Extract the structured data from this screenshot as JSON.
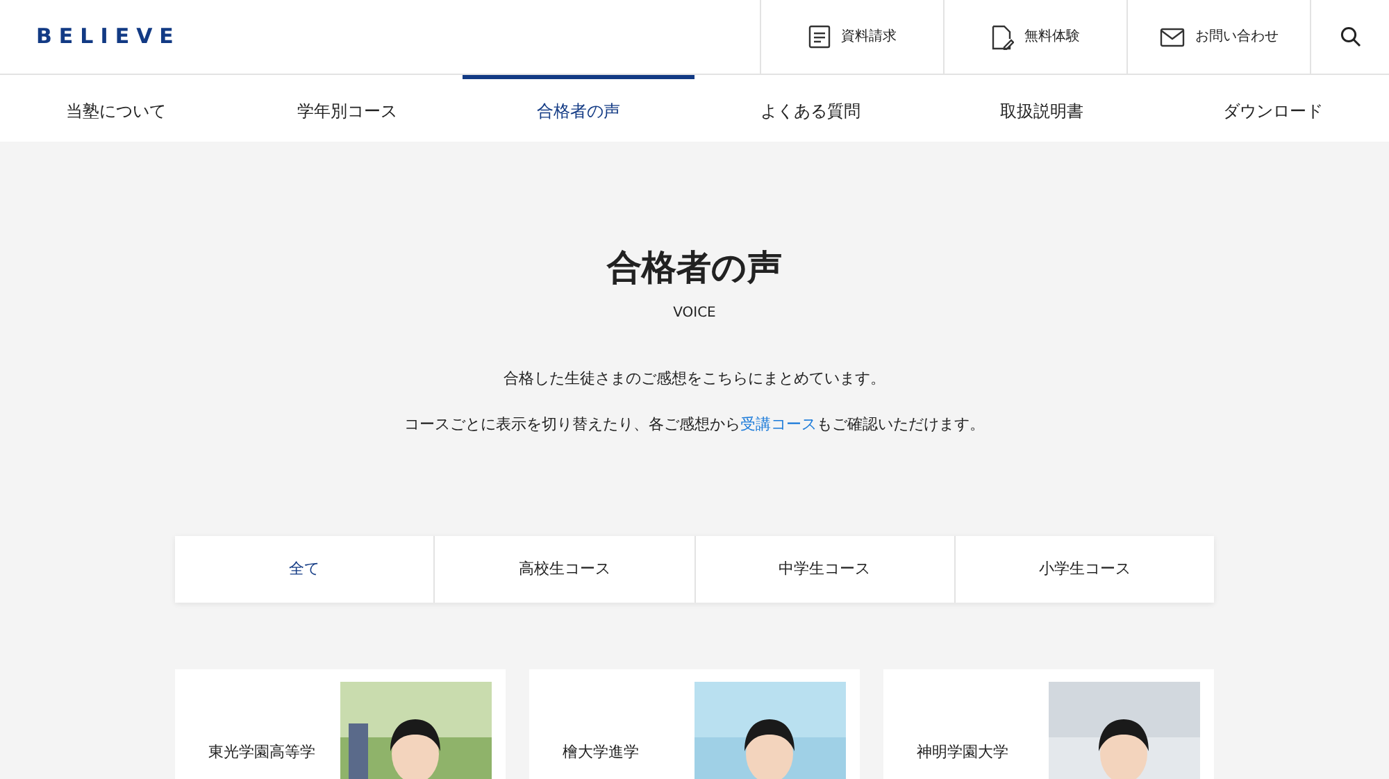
{
  "logo": "BELIEVE",
  "header_links": [
    {
      "kind": "document",
      "label": "資料請求"
    },
    {
      "kind": "trial",
      "label": "無料体験"
    },
    {
      "kind": "mail",
      "label": "お問い合わせ"
    },
    {
      "kind": "search"
    }
  ],
  "nav": [
    {
      "label": "当塾について",
      "selected": false
    },
    {
      "label": "学年別コース",
      "selected": false
    },
    {
      "label": "合格者の声",
      "selected": true
    },
    {
      "label": "よくある質問",
      "selected": false
    },
    {
      "label": "取扱説明書",
      "selected": false
    },
    {
      "label": "ダウンロード",
      "selected": false
    }
  ],
  "page_title": "合格者の声",
  "page_subtitle": "VOICE",
  "intro": [
    {
      "text": "合格した生徒さまのご感想をこちらにまとめています。"
    },
    {
      "text": "コースごとに表示を切り替えたり、各ご感想から",
      "link": "受講コース",
      "after": "もご確認いただけます。"
    }
  ],
  "filters": [
    {
      "label": "全て",
      "selected": true
    },
    {
      "label": "高校生コース",
      "selected": false
    },
    {
      "label": "中学生コース",
      "selected": false
    },
    {
      "label": "小学生コース",
      "selected": false
    }
  ],
  "cards": [
    {
      "school": "東光学園高等学",
      "kind": "picture"
    },
    {
      "school": "檜大学進学",
      "kind": "picture"
    },
    {
      "school": "神明学園大学",
      "kind": "picture"
    }
  ]
}
